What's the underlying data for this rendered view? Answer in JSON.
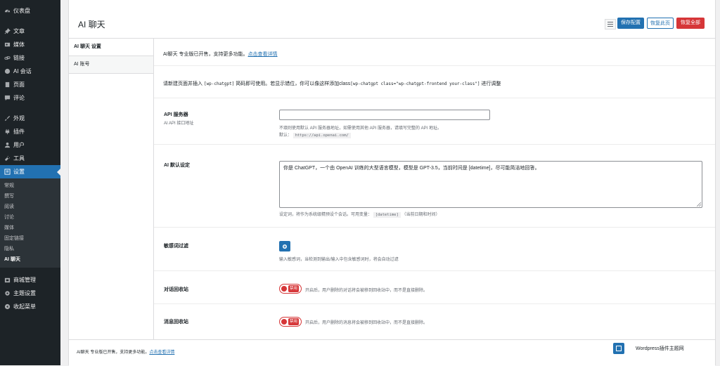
{
  "sidebar": {
    "items": [
      {
        "label": "仪表盘",
        "icon": "dashboard-icon"
      },
      {
        "label": "文章",
        "icon": "pin-icon"
      },
      {
        "label": "媒体",
        "icon": "media-icon"
      },
      {
        "label": "链接",
        "icon": "link-icon"
      },
      {
        "label": "AI 会话",
        "icon": "chat-icon"
      },
      {
        "label": "页面",
        "icon": "page-icon"
      },
      {
        "label": "评论",
        "icon": "comment-icon"
      },
      {
        "label": "外观",
        "icon": "brush-icon"
      },
      {
        "label": "插件",
        "icon": "plugin-icon"
      },
      {
        "label": "用户",
        "icon": "user-icon"
      },
      {
        "label": "工具",
        "icon": "wrench-icon"
      },
      {
        "label": "设置",
        "icon": "settings-icon"
      }
    ],
    "submenu": [
      "常规",
      "撰写",
      "阅读",
      "讨论",
      "媒体",
      "固定链接",
      "隐私",
      "AI 聊天"
    ],
    "after": [
      {
        "label": "商城管理",
        "icon": "shop-icon"
      },
      {
        "label": "主题设置",
        "icon": "gear-icon"
      },
      {
        "label": "收起菜单",
        "icon": "collapse-icon"
      }
    ]
  },
  "header": {
    "title": "AI 聊天",
    "save": "保存配置",
    "restore_page": "恢复此页",
    "restore_all": "恢复全部"
  },
  "tabs": [
    "AI 聊天 设置",
    "AI 账号"
  ],
  "notice": {
    "text": "AI聊天 专业版已开售，支持更多功能。",
    "link": "点击查看详情"
  },
  "shortcode": {
    "pre": "请新建页面并插入",
    "code1": "[wp-chatgpt]",
    "mid": "简码即可使用。若显示错位，你可以像这样添加class",
    "code2": "[wp-chatgpt class=\"wp-chatgpt-frontend your-class\"]",
    "post": "进行调整"
  },
  "fields": {
    "api": {
      "label": "API 服务器",
      "sub": "AI API 接口地址",
      "desc": "不填则使用默认 API 服务器地址，如需使用其他 API 服务器，请填写完整的 API 地址。",
      "default_label": "默认：",
      "default_value": "https://api.openai.com/"
    },
    "system": {
      "label": "AI 默认设定",
      "value": "你是 ChatGPT，一个由 OpenAI 训练的大型语言模型，模型是 GPT-3.5，当前时间是 [datetime]，尽可能简洁地回答。",
      "desc": "设定词，将作为系统级精预设个会话。可用变量：",
      "var": "[datetime]",
      "var_desc": "（当前日期和时间）"
    },
    "filter": {
      "label": "敏感词过滤",
      "desc": "输入敏感词，当检测到输出/输入中包含敏感词时，将会自动过滤"
    },
    "conv_bin": {
      "label": "对话回收站",
      "toggle": "禁用",
      "desc": "开启后，用户删除的对话将会被移到回收站中，而不是直接删除。"
    },
    "msg_bin": {
      "label": "消息回收站",
      "toggle": "禁用",
      "desc": "开启后，用户删除的消息将会被移到回收站中，而不是直接删除。"
    }
  },
  "footer": {
    "text": "AI聊天 专业版已开售，支持更多功能。",
    "link": "点击查看详情",
    "site": "Wordpress插件主题网"
  },
  "colors": {
    "primary": "#2271b1",
    "danger": "#d63638",
    "sidebar": "#1d2327"
  }
}
